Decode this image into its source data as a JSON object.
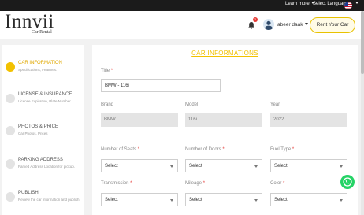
{
  "topbar": {
    "learn_more": "Learn more",
    "select_language": "Select Language",
    "flag_icon": "us-flag-icon"
  },
  "header": {
    "logo_text": "Innvii",
    "logo_sub": "Car Rental",
    "notification_count": "2",
    "username": "abeer daak",
    "rent_button": "Rent Your Car"
  },
  "sidebar": {
    "steps": [
      {
        "title": "CAR INFORMATION",
        "desc": "Specifications, Features."
      },
      {
        "title": "LICENSE & INSURANCE",
        "desc": "License Expiration, Plate Number."
      },
      {
        "title": "PHOTOS & PRICE",
        "desc": "Car Photos, Prices"
      },
      {
        "title": "PARKING ADDRESS",
        "desc": "Parked Address Location for pickup."
      },
      {
        "title": "PUBLISH",
        "desc": "Review the car information and publish."
      }
    ]
  },
  "form": {
    "section_title": "CAR INFORMATIONS",
    "title_label": "Title",
    "title_value": "BMW - 116i",
    "brand_label": "Brand",
    "brand_value": "BMW",
    "model_label": "Model",
    "model_value": "116i",
    "year_label": "Year",
    "year_value": "2022",
    "seats_label": "Number of Seats",
    "doors_label": "Number of Doors",
    "fuel_label": "Fuel Type",
    "transmission_label": "Transmission",
    "mileage_label": "Mileage",
    "color_label": "Color",
    "select_placeholder": "Select",
    "required_mark": "*"
  },
  "colors": {
    "accent": "#f2c100",
    "required": "#e53935",
    "whatsapp": "#25d366"
  }
}
